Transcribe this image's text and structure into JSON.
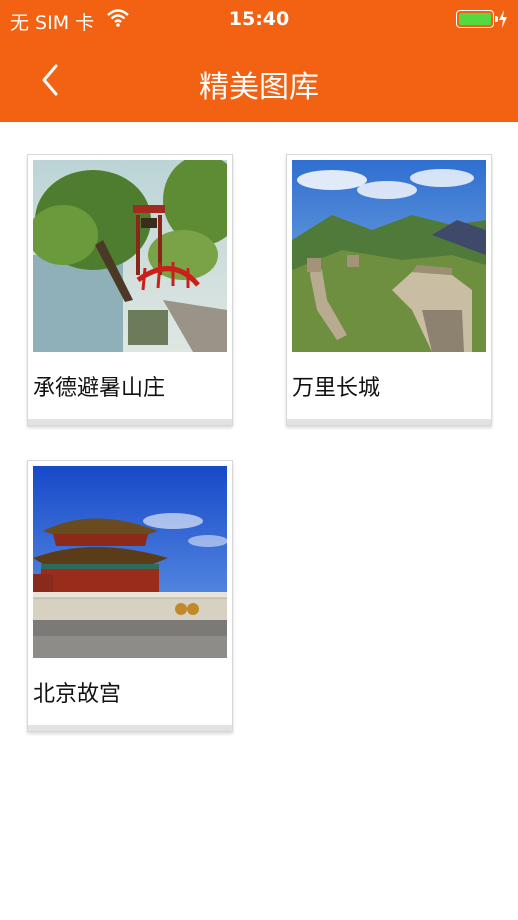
{
  "status_bar": {
    "carrier": "无 SIM 卡",
    "wifi_icon": "wifi-icon",
    "time": "15:40",
    "battery_level": 1.0,
    "battery_color": "#58d83f",
    "charging_icon": "charging-bolt-icon"
  },
  "navbar": {
    "back_icon": "back-chevron-icon",
    "title": "精美图库",
    "background_color": "#f26212"
  },
  "gallery": {
    "items": [
      {
        "caption": "承德避暑山庄",
        "image": "summer-resort-photo"
      },
      {
        "caption": "万里长城",
        "image": "great-wall-photo"
      },
      {
        "caption": "北京故宫",
        "image": "forbidden-city-photo"
      }
    ]
  }
}
